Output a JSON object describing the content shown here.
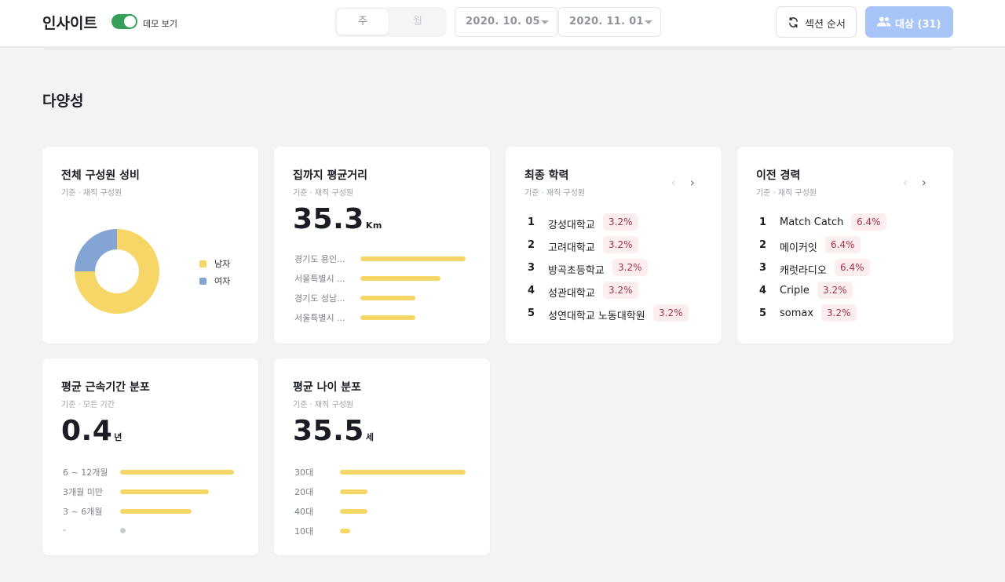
{
  "header": {
    "title": "인사이트",
    "demo_label": "데모 보기",
    "demo_on": true,
    "period_tabs": [
      {
        "label": "주",
        "active": true
      },
      {
        "label": "월",
        "active": false
      }
    ],
    "start_date": "2020. 10. 05",
    "end_date": "2020. 11. 01",
    "order_button": "섹션 순서",
    "target_button": "대상 (31)"
  },
  "section": {
    "title": "다양성"
  },
  "cards": {
    "gender": {
      "title": "전체 구성원 성비",
      "subtitle": "기준 · 재직 구성원",
      "legend": [
        {
          "label": "남자",
          "color": "#f7d668",
          "share": 0.75
        },
        {
          "label": "여자",
          "color": "#84a4d4",
          "share": 0.25
        }
      ]
    },
    "distance": {
      "title": "집까지 평균거리",
      "subtitle": "기준 · 재직 구성원",
      "value": "35.3",
      "unit": "Km",
      "rows": [
        {
          "label": "경기도 용인...",
          "fraction": 1.0
        },
        {
          "label": "서울특별시 ...",
          "fraction": 0.76
        },
        {
          "label": "경기도 성남...",
          "fraction": 0.52
        },
        {
          "label": "서울특별시 ...",
          "fraction": 0.52
        }
      ]
    },
    "education": {
      "title": "최종 학력",
      "subtitle": "기준 · 재직 구성원",
      "items": [
        {
          "rank": "1",
          "name": "강성대학교",
          "pct": "3.2%"
        },
        {
          "rank": "2",
          "name": "고려대학교",
          "pct": "3.2%"
        },
        {
          "rank": "3",
          "name": "방곡초등학교",
          "pct": "3.2%"
        },
        {
          "rank": "4",
          "name": "성관대학교",
          "pct": "3.2%"
        },
        {
          "rank": "5",
          "name": "성연대학교 노동대학원",
          "pct": "3.2%"
        }
      ]
    },
    "career": {
      "title": "이전 경력",
      "subtitle": "기준 · 재직 구성원",
      "items": [
        {
          "rank": "1",
          "name": "Match Catch",
          "pct": "6.4%"
        },
        {
          "rank": "2",
          "name": "메이커잇",
          "pct": "6.4%"
        },
        {
          "rank": "3",
          "name": "캐럿라디오",
          "pct": "6.4%"
        },
        {
          "rank": "4",
          "name": "Criple",
          "pct": "3.2%"
        },
        {
          "rank": "5",
          "name": "somax",
          "pct": "3.2%"
        }
      ]
    },
    "tenure": {
      "title": "평균 근속기간 분포",
      "subtitle": "기준 · 모든 기간",
      "value": "0.4",
      "unit": "년",
      "rows": [
        {
          "label": "6 ~ 12개월",
          "fraction": 1.0
        },
        {
          "label": "3개월 미만",
          "fraction": 0.78
        },
        {
          "label": "3 ~ 6개월",
          "fraction": 0.63
        },
        {
          "label": "-",
          "fraction": 0
        }
      ]
    },
    "age": {
      "title": "평균 나이 분포",
      "subtitle": "기준 · 재직 구성원",
      "value": "35.5",
      "unit": "세",
      "rows": [
        {
          "label": "30대",
          "fraction": 1.0
        },
        {
          "label": "20대",
          "fraction": 0.22
        },
        {
          "label": "40대",
          "fraction": 0.22
        },
        {
          "label": "10대",
          "fraction": 0.08
        }
      ]
    }
  }
}
